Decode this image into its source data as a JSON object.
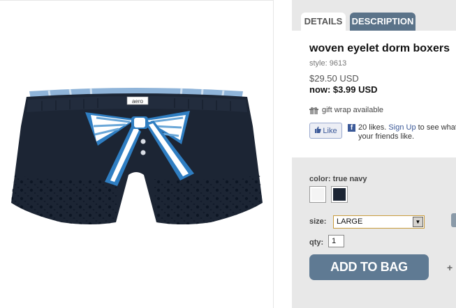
{
  "tabs": {
    "details": "DETAILS",
    "description": "DESCRIPTION"
  },
  "product": {
    "title": "woven eyelet dorm boxers",
    "style": "style: 9613",
    "price": "$29.50 USD",
    "now_price": "now: $3.99 USD",
    "gift_wrap": "gift wrap available",
    "waistband_label": "aero"
  },
  "social": {
    "like_label": "Like",
    "fb_logo": "f",
    "likes_count": "20 likes.",
    "signup_link": "Sign Up",
    "likes_suffix": "to see what your friends like."
  },
  "options": {
    "color_label": "color: true navy",
    "swatches": [
      {
        "name": "white",
        "color": "#f4f4f4"
      },
      {
        "name": "true navy",
        "color": "#1c2534"
      }
    ],
    "size_label": "size:",
    "size_value": "LARGE",
    "size_arrow": "▼",
    "qty_label": "qty:",
    "qty_value": "1"
  },
  "actions": {
    "add_to_bag": "ADD TO BAG",
    "plus": "+"
  },
  "colors": {
    "tab_active_bg": "#ffffff",
    "tab_inactive_bg": "#5b7389",
    "panel_bg": "#e8e8e8",
    "button_bg": "#5f7a93",
    "facebook_blue": "#3b5998",
    "select_border": "#c89b3c"
  }
}
